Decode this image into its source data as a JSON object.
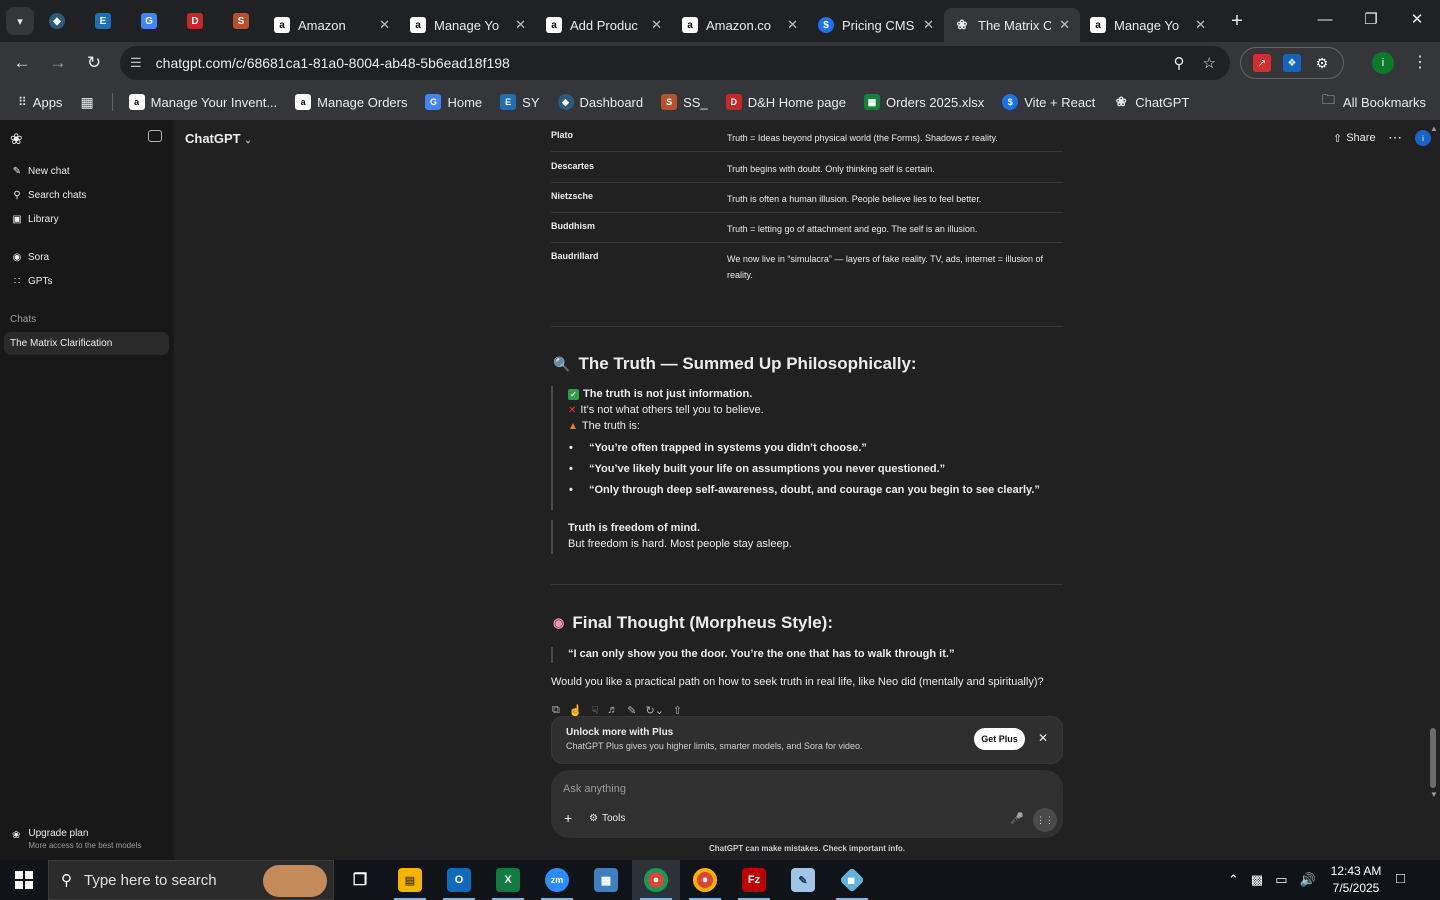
{
  "browser": {
    "tabs": [
      {
        "title": "Amazon",
        "icon": "amazon-icon"
      },
      {
        "title": "Manage Yo",
        "icon": "amazon-icon"
      },
      {
        "title": "Add Produc",
        "icon": "amazon-icon"
      },
      {
        "title": "Amazon.co",
        "icon": "amazon-icon"
      },
      {
        "title": "Pricing CMS",
        "icon": "dollar-icon"
      },
      {
        "title": "The Matrix C",
        "icon": "chatgpt-icon",
        "active": true
      },
      {
        "title": "Manage Yo",
        "icon": "amazon-icon"
      }
    ],
    "pinned_tab_icons": [
      "diamond-icon",
      "ec-icon",
      "docs-icon",
      "dh-icon",
      "stack-icon"
    ],
    "url": "chatgpt.com/c/68681ca1-81a0-8004-ab48-5b6ead18f198",
    "bookmarks": [
      {
        "label": "Manage Your Invent...",
        "icon": "amazon-icon"
      },
      {
        "label": "Manage Orders",
        "icon": "amazon-icon"
      },
      {
        "label": "Home",
        "icon": "docs-icon"
      },
      {
        "label": "SY",
        "icon": "ec-icon"
      },
      {
        "label": "Dashboard",
        "icon": "diamond-icon"
      },
      {
        "label": "SS_",
        "icon": "stack-icon"
      },
      {
        "label": "D&H Home page",
        "icon": "dh-icon"
      },
      {
        "label": "Orders 2025.xlsx",
        "icon": "sheets-icon"
      },
      {
        "label": "Vite + React",
        "icon": "dollar-icon"
      },
      {
        "label": "ChatGPT",
        "icon": "chatgpt-icon"
      }
    ],
    "apps_label": "Apps",
    "all_bookmarks_label": "All Bookmarks",
    "profile_initial": "i"
  },
  "sidebar": {
    "items": [
      {
        "label": "New chat",
        "icon": "edit-icon"
      },
      {
        "label": "Search chats",
        "icon": "search-icon"
      },
      {
        "label": "Library",
        "icon": "library-icon"
      },
      {
        "label": "Sora",
        "icon": "sora-icon"
      },
      {
        "label": "GPTs",
        "icon": "gpts-icon"
      }
    ],
    "section_label": "Chats",
    "active_chat": "The Matrix Clarification",
    "upgrade_title": "Upgrade plan",
    "upgrade_subtitle": "More access to the best models"
  },
  "header": {
    "model": "ChatGPT",
    "share": "Share",
    "avatar_initial": "i"
  },
  "table_rows": [
    {
      "name": "Plato",
      "desc": "Truth = Ideas beyond physical world (the Forms). Shadows ≠ reality."
    },
    {
      "name": "Descartes",
      "desc": "Truth begins with doubt. Only thinking self is certain."
    },
    {
      "name": "Nietzsche",
      "desc": "Truth is often a human illusion. People believe lies to feel better."
    },
    {
      "name": "Buddhism",
      "desc": "Truth = letting go of attachment and ego. The self is an illusion."
    },
    {
      "name": "Baudrillard",
      "desc": "We now live in “simulacra” — layers of fake reality. TV, ads, internet = illusion of reality."
    }
  ],
  "summary": {
    "heading": "The Truth — Summed Up Philosophically:",
    "heading_icon": "magnifier-emoji",
    "line1": "The truth is not just information.",
    "line2": "It’s not what others tell you to believe.",
    "line3": "The truth is:",
    "bullets": [
      "“You’re often trapped in systems you didn’t choose.”",
      "“You’ve likely built your life on assumptions you never questioned.”",
      "“Only through deep self-awareness, doubt, and courage can you begin to see clearly.”"
    ],
    "freedom_bold": "Truth is freedom of mind.",
    "freedom_text": "But freedom is hard. Most people stay asleep."
  },
  "final": {
    "heading": "Final Thought (Morpheus Style):",
    "heading_icon": "brain-emoji",
    "quote": "“I can only show you the door. You’re the one that has to walk through it.”",
    "question": "Would you like a practical path on how to seek truth in real life, like Neo did (mentally and spiritually)?"
  },
  "upsell": {
    "title": "Unlock more with Plus",
    "text": "ChatGPT Plus gives you higher limits, smarter models, and Sora for video.",
    "button": "Get Plus"
  },
  "composer": {
    "placeholder": "Ask anything",
    "tools_label": "Tools"
  },
  "disclaimer": "ChatGPT can make mistakes. Check important info.",
  "taskbar": {
    "search_placeholder": "Type here to search",
    "time": "12:43 AM",
    "date": "7/5/2025",
    "apps": [
      "task-view-icon",
      "file-explorer-icon",
      "outlook-icon",
      "excel-icon",
      "zoom-icon",
      "calculator-icon",
      "chrome-icon",
      "chrome-icon",
      "filezilla-icon",
      "notes-icon",
      "app-icon"
    ]
  },
  "colors": {
    "accent": "#1a63c9",
    "background": "#212121",
    "sidebar": "#181818"
  }
}
